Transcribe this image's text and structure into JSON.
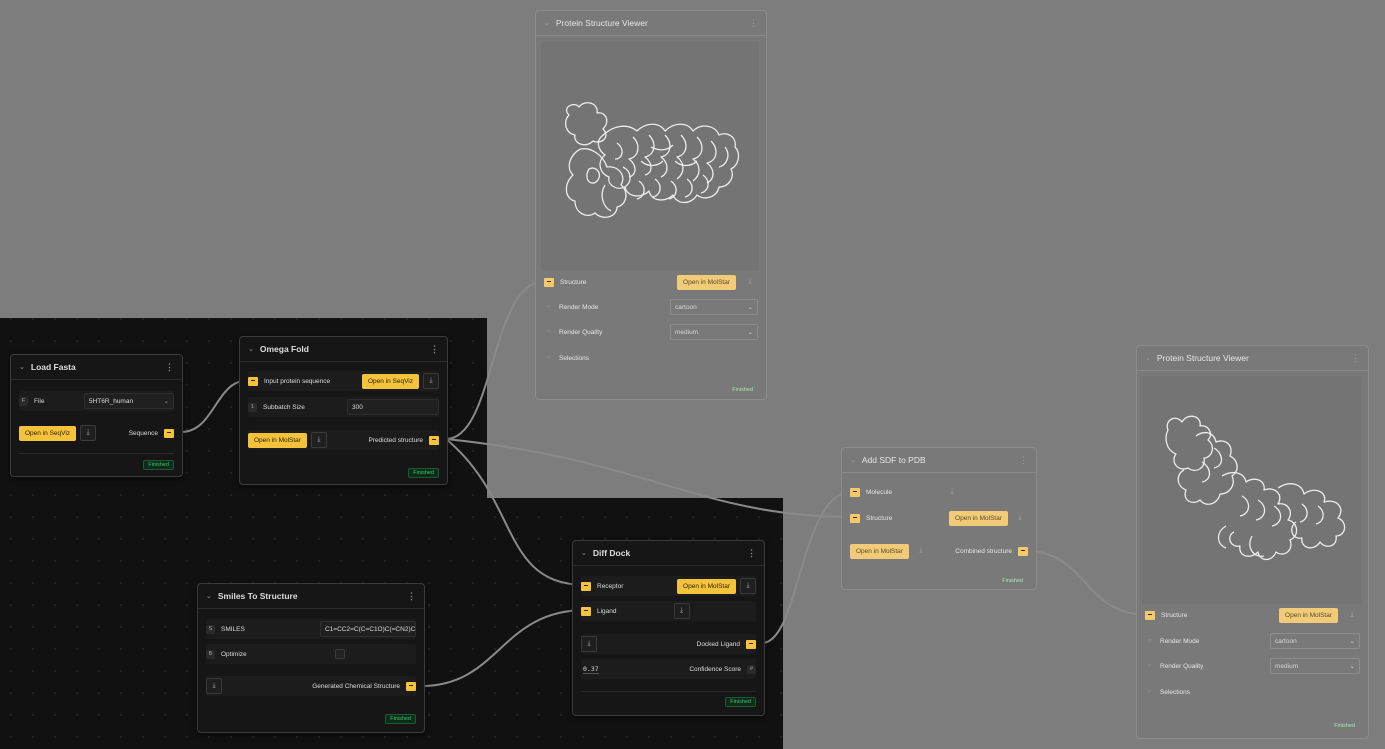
{
  "colors": {
    "accent": "#f5c33b",
    "success": "#39c46d",
    "wire": "#7d7d7d"
  },
  "load_fasta": {
    "title": "Load Fasta",
    "file_label": "File",
    "file_value": "5HT6R_human",
    "open_button": "Open in SeqViz",
    "output_label": "Sequence",
    "status": "Finished"
  },
  "omega_fold": {
    "title": "Omega Fold",
    "input_label": "Input protein sequence",
    "open_seqviz": "Open in SeqViz",
    "subbatch_label": "Subbatch Size",
    "subbatch_value": "300",
    "open_molstar": "Open in MolStar",
    "output_label": "Predicted structure",
    "status": "Finished"
  },
  "smiles": {
    "title": "Smiles To Structure",
    "smiles_label": "SMILES",
    "smiles_value": "C1=CC2=C(C=C1O)C(=CN2)C",
    "optimize_label": "Optimize",
    "output_label": "Generated Chemical Structure",
    "status": "Finished"
  },
  "diffdock": {
    "title": "Diff Dock",
    "receptor_label": "Receptor",
    "open_molstar": "Open in MolStar",
    "ligand_label": "Ligand",
    "docked_label": "Docked Ligand",
    "confidence_value": "0.37",
    "confidence_label": "Confidence Score",
    "status": "Finished"
  },
  "viewer1": {
    "title": "Protein Structure Viewer",
    "structure_label": "Structure",
    "open_molstar": "Open in MolStar",
    "render_mode_label": "Render Mode",
    "render_mode_value": "cartoon",
    "render_quality_label": "Render Quality",
    "render_quality_value": "medium",
    "selections_label": "Selections",
    "status": "Finished"
  },
  "addsdf": {
    "title": "Add SDF to PDB",
    "molecule_label": "Molecule",
    "structure_label": "Structure",
    "open_molstar_1": "Open in MolStar",
    "open_molstar_2": "Open in MolStar",
    "output_label": "Combined structure",
    "status": "Finished"
  },
  "viewer2": {
    "title": "Protein Structure Viewer",
    "structure_label": "Structure",
    "open_molstar": "Open in MolStar",
    "render_mode_label": "Render Mode",
    "render_mode_value": "cartoon",
    "render_quality_label": "Render Quality",
    "render_quality_value": "medium",
    "selections_label": "Selections",
    "status": "Finished"
  }
}
